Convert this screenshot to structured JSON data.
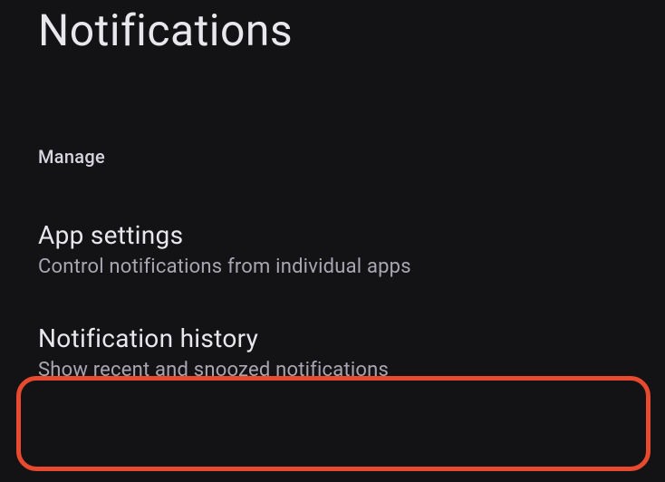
{
  "page": {
    "title": "Notifications"
  },
  "section": {
    "header": "Manage"
  },
  "items": [
    {
      "title": "App settings",
      "description": "Control notifications from individual apps"
    },
    {
      "title": "Notification history",
      "description": "Show recent and snoozed notifications"
    }
  ],
  "annotation": {
    "highlight_color": "#e74a2e",
    "highlighted_index": 1
  }
}
